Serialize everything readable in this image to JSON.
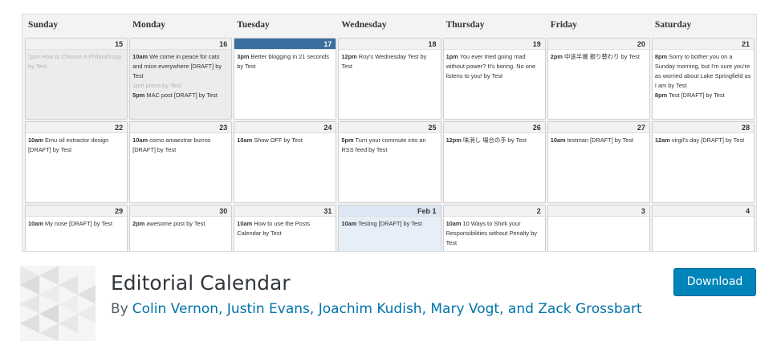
{
  "calendar": {
    "day_headers": [
      "Sunday",
      "Monday",
      "Tuesday",
      "Wednesday",
      "Thursday",
      "Friday",
      "Saturday"
    ],
    "weeks": [
      [
        {
          "day": "15",
          "state": "past",
          "posts": [
            {
              "time": "1pm",
              "title": "How to Choose a Philanthropy by Test",
              "faded": true
            }
          ]
        },
        {
          "day": "16",
          "state": "past",
          "posts": [
            {
              "time": "10am",
              "title": "We come in peace for cats and mice everywhere [DRAFT] by Test"
            },
            {
              "time": "1pm",
              "title": "prova by Test",
              "faded": true
            },
            {
              "time": "5pm",
              "title": "MAC post [DRAFT] by Test"
            }
          ]
        },
        {
          "day": "17",
          "state": "today",
          "posts": [
            {
              "time": "3pm",
              "title": "Better blogging in 21 seconds by Test"
            }
          ]
        },
        {
          "day": "18",
          "state": "",
          "posts": [
            {
              "time": "12pm",
              "title": "Roy's Wednesday Test by Test"
            }
          ]
        },
        {
          "day": "19",
          "state": "",
          "posts": [
            {
              "time": "1pm",
              "title": "You ever tried going mad without power? It's boring. No one listens to you! by Test"
            }
          ]
        },
        {
          "day": "20",
          "state": "",
          "posts": [
            {
              "time": "2pm",
              "title": "中途半端 振り替わり by Test"
            }
          ]
        },
        {
          "day": "21",
          "state": "",
          "posts": [
            {
              "time": "8pm",
              "title": "Sorry to bother you on a Sunday morning, but I'm sure you're as worried about Lake Springfield as I am by Test"
            },
            {
              "time": "8pm",
              "title": "Test [DRAFT] by Test"
            }
          ]
        }
      ],
      [
        {
          "day": "22",
          "state": "",
          "posts": [
            {
              "time": "10am",
              "title": "Emu oil extractor design [DRAFT] by Test"
            }
          ]
        },
        {
          "day": "23",
          "state": "",
          "posts": [
            {
              "time": "10am",
              "title": "como amaestrar burros [DRAFT] by Test"
            }
          ]
        },
        {
          "day": "24",
          "state": "",
          "posts": [
            {
              "time": "10am",
              "title": "Show OFF by Test"
            }
          ]
        },
        {
          "day": "25",
          "state": "",
          "posts": [
            {
              "time": "5pm",
              "title": "Turn your commute into an RSS feed by Test"
            }
          ]
        },
        {
          "day": "26",
          "state": "",
          "posts": [
            {
              "time": "12pm",
              "title": "味消し 場合の手 by Test"
            }
          ]
        },
        {
          "day": "27",
          "state": "",
          "posts": [
            {
              "time": "10am",
              "title": "testman [DRAFT] by Test"
            }
          ]
        },
        {
          "day": "28",
          "state": "",
          "posts": [
            {
              "time": "12am",
              "title": "virgil's day [DRAFT] by Test"
            }
          ]
        }
      ],
      [
        {
          "day": "29",
          "state": "",
          "posts": [
            {
              "time": "10am",
              "title": "My nose [DRAFT] by Test"
            }
          ]
        },
        {
          "day": "30",
          "state": "",
          "posts": [
            {
              "time": "2pm",
              "title": "awesome post by Test"
            }
          ]
        },
        {
          "day": "31",
          "state": "",
          "posts": [
            {
              "time": "10am",
              "title": "How to use the Posts Calendar by Test"
            }
          ]
        },
        {
          "day": "Feb 1",
          "state": "highlight",
          "posts": [
            {
              "time": "10am",
              "title": "Testing [DRAFT] by Test"
            }
          ]
        },
        {
          "day": "2",
          "state": "",
          "posts": [
            {
              "time": "10am",
              "title": "10 Ways to Shirk your Responsibilities without Penalty by Test"
            }
          ]
        },
        {
          "day": "3",
          "state": "",
          "posts": []
        },
        {
          "day": "4",
          "state": "",
          "posts": []
        }
      ]
    ]
  },
  "plugin": {
    "title": "Editorial Calendar",
    "by": "By",
    "authors": "Colin Vernon, Justin Evans, Joachim Kudish, Mary Vogt, and Zack Grossbart",
    "download_label": "Download",
    "icon": "geometric-pattern-icon"
  }
}
